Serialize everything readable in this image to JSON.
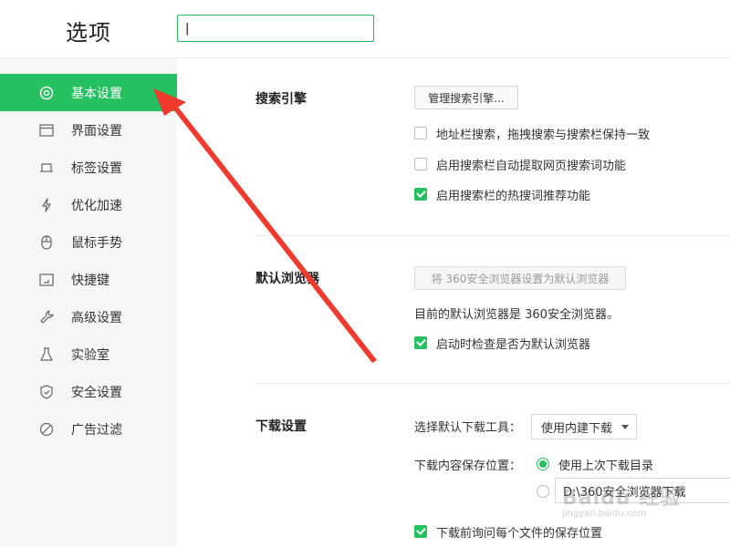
{
  "header": {
    "title": "选项",
    "search_value": "|"
  },
  "sidebar": {
    "items": [
      {
        "label": "基本设置",
        "icon": "gear-icon",
        "active": true
      },
      {
        "label": "界面设置",
        "icon": "window-icon",
        "active": false
      },
      {
        "label": "标签设置",
        "icon": "tab-icon",
        "active": false
      },
      {
        "label": "优化加速",
        "icon": "lightning-icon",
        "active": false
      },
      {
        "label": "鼠标手势",
        "icon": "mouse-icon",
        "active": false
      },
      {
        "label": "快捷键",
        "icon": "keyboard-icon",
        "active": false
      },
      {
        "label": "高级设置",
        "icon": "wrench-icon",
        "active": false
      },
      {
        "label": "实验室",
        "icon": "flask-icon",
        "active": false
      },
      {
        "label": "安全设置",
        "icon": "shield-icon",
        "active": false
      },
      {
        "label": "广告过滤",
        "icon": "ban-icon",
        "active": false
      }
    ]
  },
  "search_engine": {
    "title": "搜索引擎",
    "manage_button": "管理搜索引擎...",
    "options": [
      {
        "label": "地址栏搜索，拖拽搜索与搜索栏保持一致",
        "checked": false
      },
      {
        "label": "启用搜索栏自动提取网页搜索词功能",
        "checked": false
      },
      {
        "label": "启用搜索栏的热搜词推荐功能",
        "checked": true
      }
    ]
  },
  "default_browser": {
    "title": "默认浏览器",
    "set_button": "将 360安全浏览器设置为默认浏览器",
    "status_text": "目前的默认浏览器是 360安全浏览器。",
    "check_option": {
      "label": "启动时检查是否为默认浏览器",
      "checked": true
    }
  },
  "download": {
    "title": "下载设置",
    "tool_label": "选择默认下载工具：",
    "tool_selected": "使用内建下载",
    "location_label": "下载内容保存位置：",
    "radio_last": {
      "label": "使用上次下载目录",
      "checked": true
    },
    "radio_custom": {
      "checked": false
    },
    "path_value": "D:\\360安全浏览器下载",
    "ask_option": {
      "label": "下载前询问每个文件的保存位置",
      "checked": true
    }
  },
  "watermark": {
    "text": "Baidu 经验",
    "sub": "jingyan.baidu.com"
  },
  "colors": {
    "accent": "#25c160",
    "annotation_arrow": "#f03a2e"
  }
}
